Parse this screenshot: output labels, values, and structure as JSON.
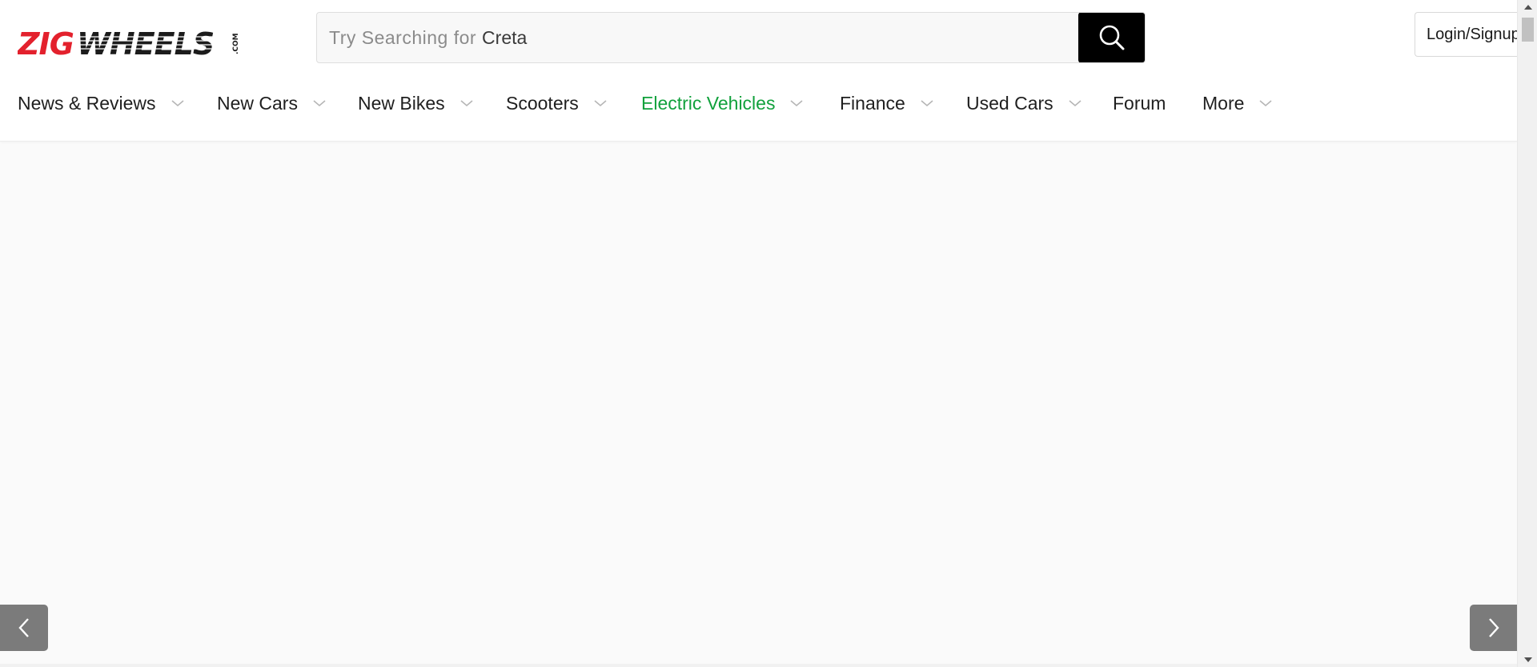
{
  "brand": {
    "logo_text": "ZIGWHEELS",
    "logo_suffix": ".COM",
    "primary_color": "#e3212d",
    "dark_color": "#1c1c1c"
  },
  "search": {
    "placeholder": "Try Searching for",
    "suggestion": "Creta",
    "icon": "search-icon"
  },
  "account": {
    "login_label": "Login/Signup"
  },
  "nav": {
    "items": [
      {
        "label": "News & Reviews",
        "has_dropdown": true
      },
      {
        "label": "New Cars",
        "has_dropdown": true
      },
      {
        "label": "New Bikes",
        "has_dropdown": true
      },
      {
        "label": "Scooters",
        "has_dropdown": true
      },
      {
        "label": "Electric Vehicles",
        "has_dropdown": true,
        "active": true
      },
      {
        "label": "Finance",
        "has_dropdown": true
      },
      {
        "label": "Used Cars",
        "has_dropdown": true
      },
      {
        "label": "Forum",
        "has_dropdown": false
      },
      {
        "label": "More",
        "has_dropdown": true
      }
    ],
    "active_color": "#11a13c"
  },
  "carousel": {
    "prev_icon": "chevron-left-icon",
    "next_icon": "chevron-right-icon"
  }
}
